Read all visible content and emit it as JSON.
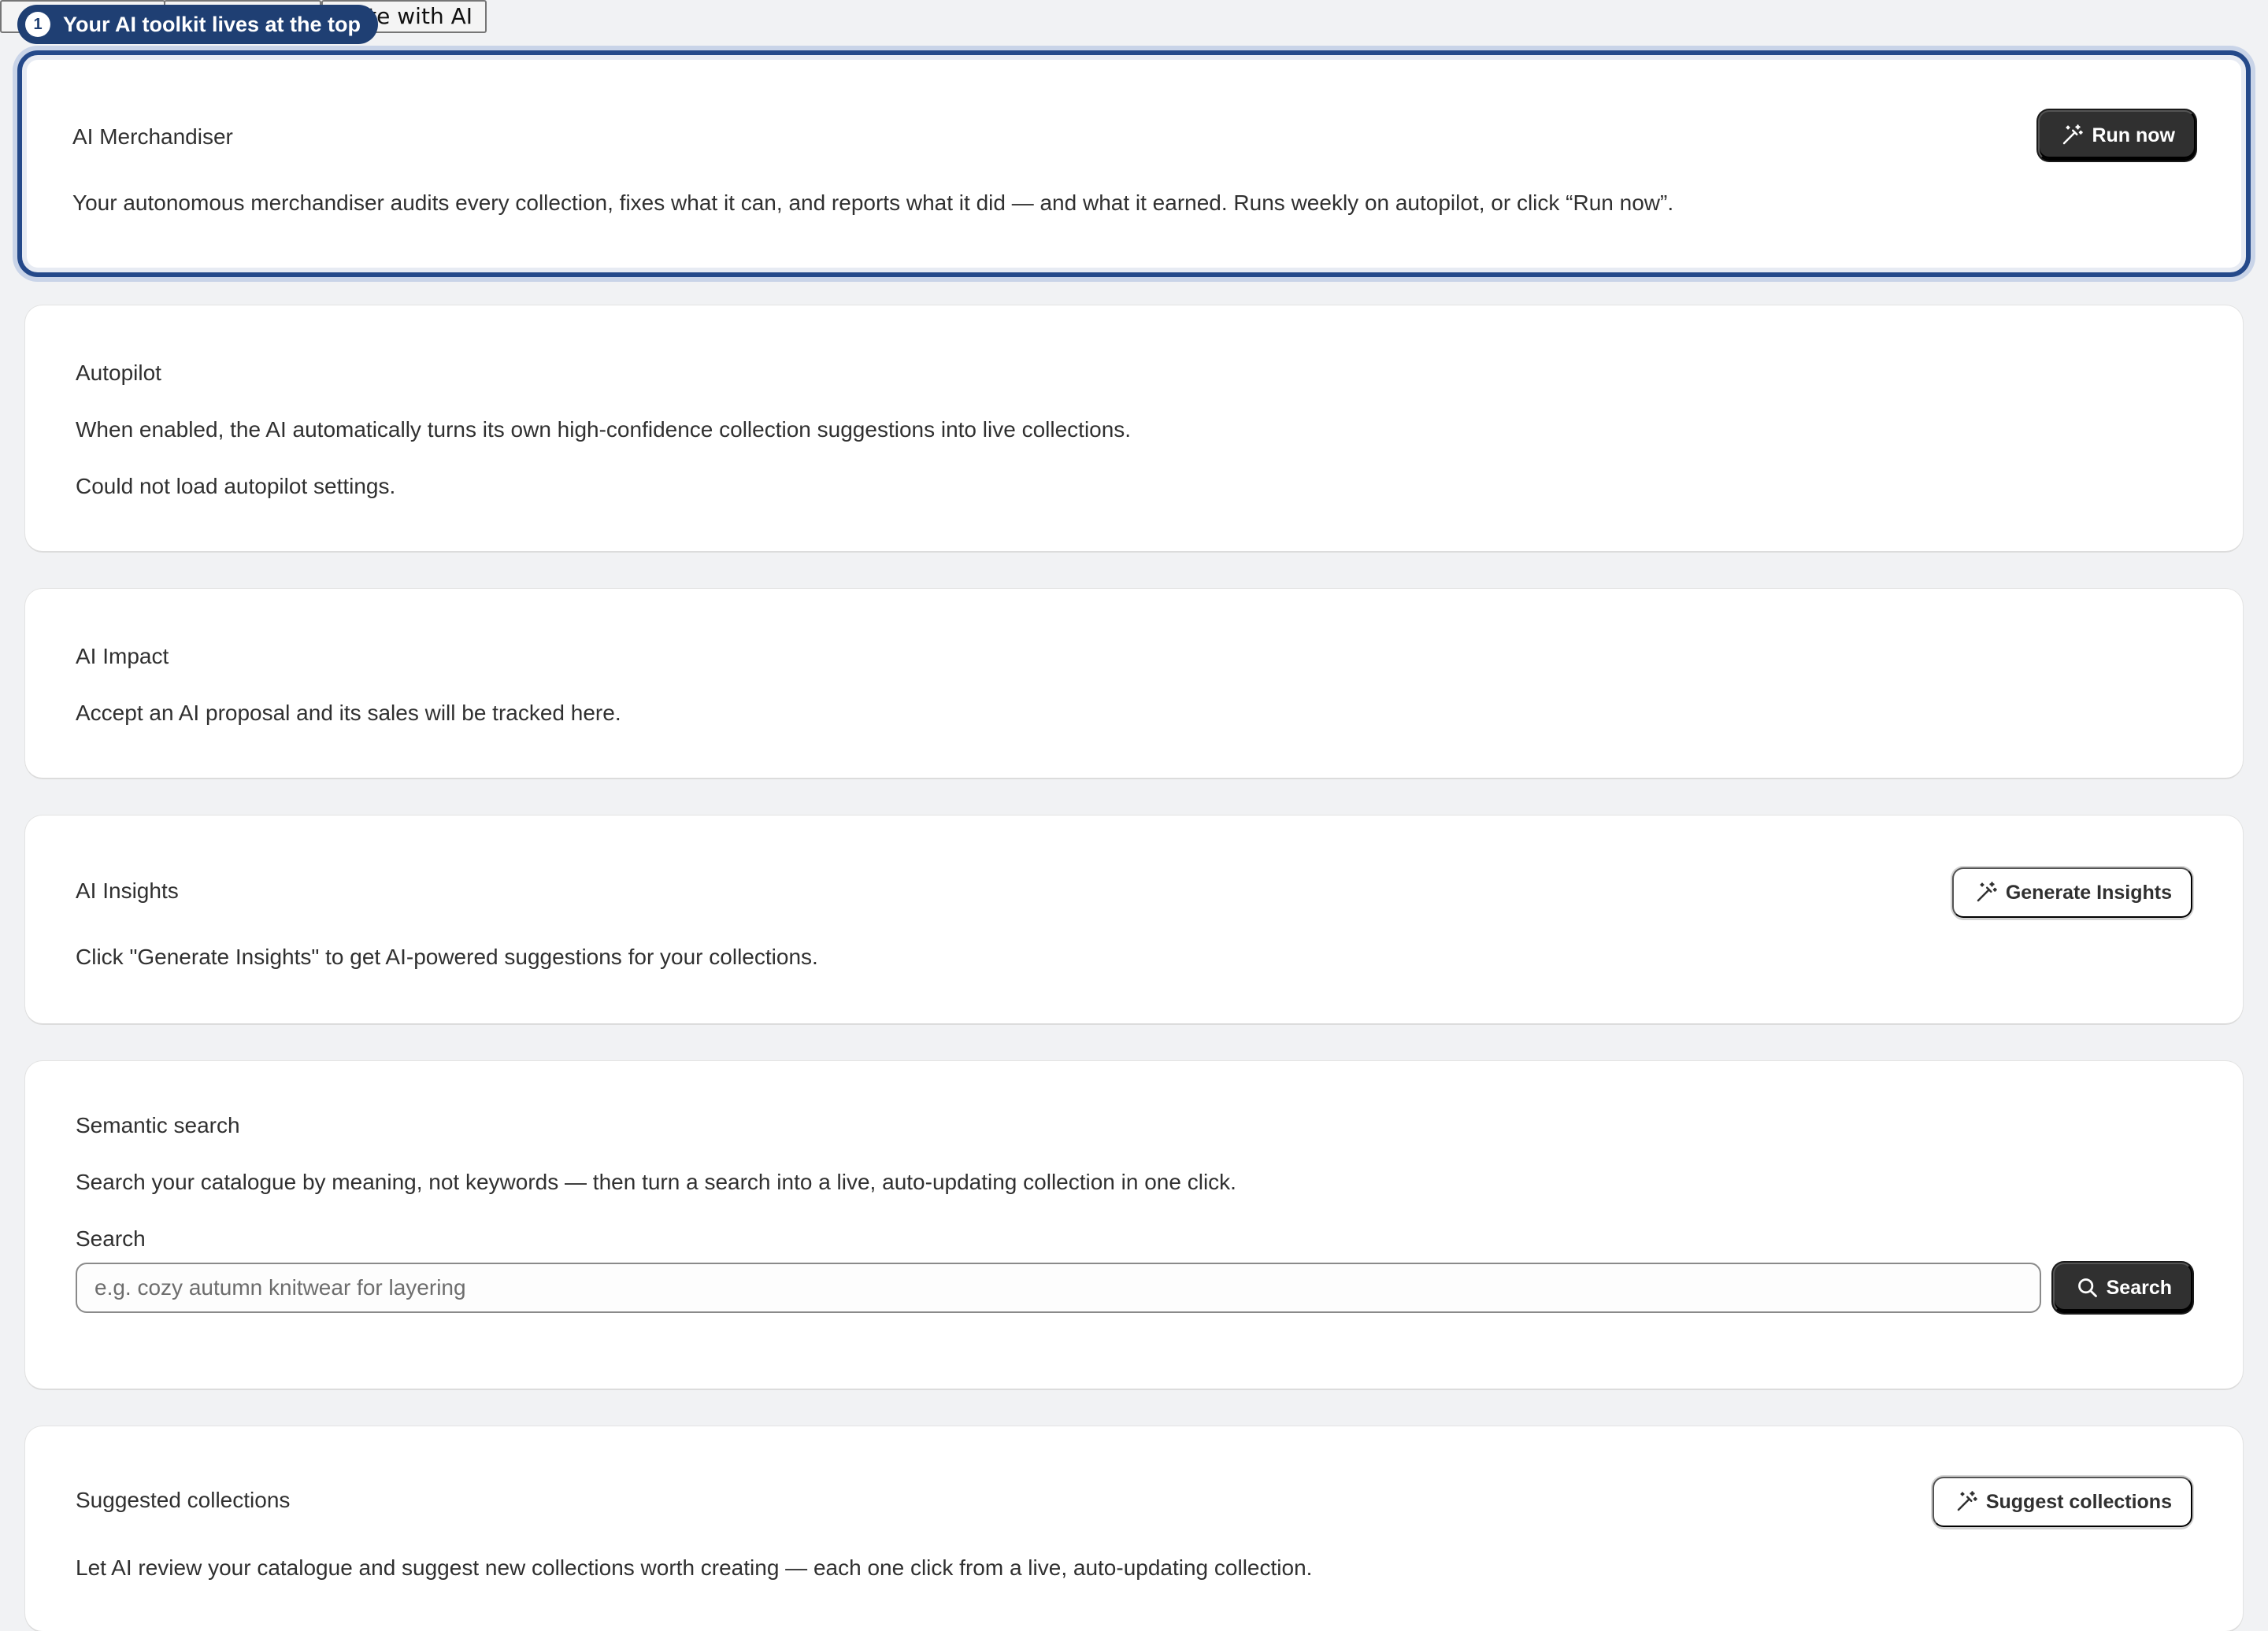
{
  "top_buttons": [
    "",
    "",
    "ate with AI"
  ],
  "tour": {
    "step": "1",
    "text": "Your AI toolkit lives at the top"
  },
  "merchandiser": {
    "title": "AI Merchandiser",
    "description": "Your autonomous merchandiser audits every collection, fixes what it can, and reports what it did — and what it earned. Runs weekly on autopilot, or click “Run now”.",
    "button": "Run now"
  },
  "autopilot": {
    "title": "Autopilot",
    "description": "When enabled, the AI automatically turns its own high-confidence collection suggestions into live collections.",
    "error": "Could not load autopilot settings."
  },
  "impact": {
    "title": "AI Impact",
    "description": "Accept an AI proposal and its sales will be tracked here."
  },
  "insights": {
    "title": "AI Insights",
    "description": "Click \"Generate Insights\" to get AI-powered suggestions for your collections.",
    "button": "Generate Insights"
  },
  "semantic": {
    "title": "Semantic search",
    "description": "Search your catalogue by meaning, not keywords — then turn a search into a live, auto-updating collection in one click.",
    "search_label": "Search",
    "placeholder": "e.g. cozy autumn knitwear for layering",
    "value": "",
    "button": "Search"
  },
  "suggested": {
    "title": "Suggested collections",
    "description": "Let AI review your catalogue and suggest new collections worth creating — each one click from a live, auto-updating collection.",
    "button": "Suggest collections"
  },
  "colors": {
    "accent": "#24498a",
    "tour_bg": "#1f3f73",
    "dark_button": "#303030",
    "page_bg": "#f1f2f4"
  },
  "icons": {
    "magic": "magic-wand-icon",
    "search": "search-icon"
  }
}
